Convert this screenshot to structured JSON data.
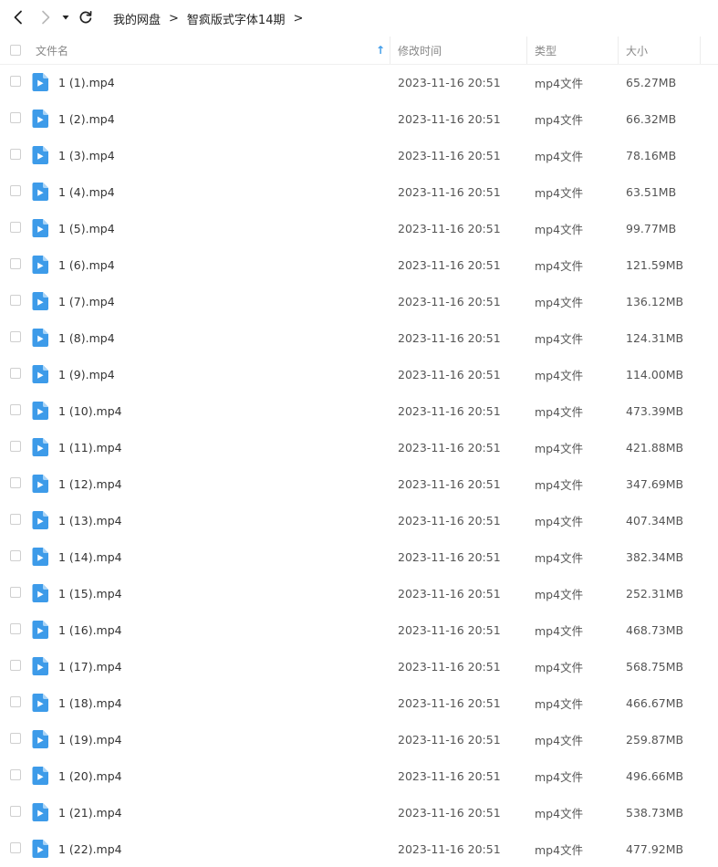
{
  "breadcrumb": [
    "我的网盘",
    "智疯版式字体14期"
  ],
  "columns": {
    "name": "文件名",
    "modified": "修改时间",
    "type": "类型",
    "size": "大小"
  },
  "sort_indicator": "↑",
  "accent_color": "#3d9be9",
  "icon_names": {
    "back": "chevron-left-icon",
    "forward": "chevron-right-icon",
    "history": "caret-down-icon",
    "refresh": "refresh-icon",
    "file": "video-file-icon"
  },
  "files": [
    {
      "name": "1 (1).mp4",
      "modified": "2023-11-16 20:51",
      "type": "mp4文件",
      "size": "65.27MB"
    },
    {
      "name": "1 (2).mp4",
      "modified": "2023-11-16 20:51",
      "type": "mp4文件",
      "size": "66.32MB"
    },
    {
      "name": "1 (3).mp4",
      "modified": "2023-11-16 20:51",
      "type": "mp4文件",
      "size": "78.16MB"
    },
    {
      "name": "1 (4).mp4",
      "modified": "2023-11-16 20:51",
      "type": "mp4文件",
      "size": "63.51MB"
    },
    {
      "name": "1 (5).mp4",
      "modified": "2023-11-16 20:51",
      "type": "mp4文件",
      "size": "99.77MB"
    },
    {
      "name": "1 (6).mp4",
      "modified": "2023-11-16 20:51",
      "type": "mp4文件",
      "size": "121.59MB"
    },
    {
      "name": "1 (7).mp4",
      "modified": "2023-11-16 20:51",
      "type": "mp4文件",
      "size": "136.12MB"
    },
    {
      "name": "1 (8).mp4",
      "modified": "2023-11-16 20:51",
      "type": "mp4文件",
      "size": "124.31MB"
    },
    {
      "name": "1 (9).mp4",
      "modified": "2023-11-16 20:51",
      "type": "mp4文件",
      "size": "114.00MB"
    },
    {
      "name": "1 (10).mp4",
      "modified": "2023-11-16 20:51",
      "type": "mp4文件",
      "size": "473.39MB"
    },
    {
      "name": "1 (11).mp4",
      "modified": "2023-11-16 20:51",
      "type": "mp4文件",
      "size": "421.88MB"
    },
    {
      "name": "1 (12).mp4",
      "modified": "2023-11-16 20:51",
      "type": "mp4文件",
      "size": "347.69MB"
    },
    {
      "name": "1 (13).mp4",
      "modified": "2023-11-16 20:51",
      "type": "mp4文件",
      "size": "407.34MB"
    },
    {
      "name": "1 (14).mp4",
      "modified": "2023-11-16 20:51",
      "type": "mp4文件",
      "size": "382.34MB"
    },
    {
      "name": "1 (15).mp4",
      "modified": "2023-11-16 20:51",
      "type": "mp4文件",
      "size": "252.31MB"
    },
    {
      "name": "1 (16).mp4",
      "modified": "2023-11-16 20:51",
      "type": "mp4文件",
      "size": "468.73MB"
    },
    {
      "name": "1 (17).mp4",
      "modified": "2023-11-16 20:51",
      "type": "mp4文件",
      "size": "568.75MB"
    },
    {
      "name": "1 (18).mp4",
      "modified": "2023-11-16 20:51",
      "type": "mp4文件",
      "size": "466.67MB"
    },
    {
      "name": "1 (19).mp4",
      "modified": "2023-11-16 20:51",
      "type": "mp4文件",
      "size": "259.87MB"
    },
    {
      "name": "1 (20).mp4",
      "modified": "2023-11-16 20:51",
      "type": "mp4文件",
      "size": "496.66MB"
    },
    {
      "name": "1 (21).mp4",
      "modified": "2023-11-16 20:51",
      "type": "mp4文件",
      "size": "538.73MB"
    },
    {
      "name": "1 (22).mp4",
      "modified": "2023-11-16 20:51",
      "type": "mp4文件",
      "size": "477.92MB"
    }
  ]
}
